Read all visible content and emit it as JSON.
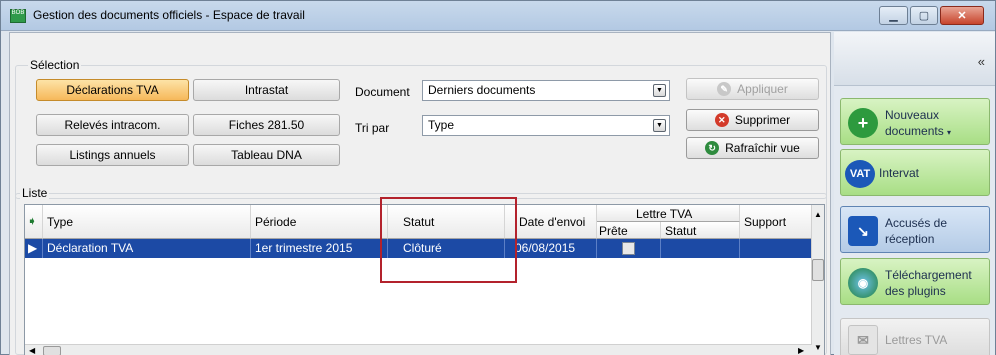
{
  "window": {
    "title": "Gestion des documents officiels - Espace de travail",
    "app_icon_text": "BOB"
  },
  "selection": {
    "group_label": "Sélection",
    "buttons": [
      {
        "label": "Déclarations TVA",
        "active": true
      },
      {
        "label": "Intrastat",
        "active": false
      },
      {
        "label": "Relevés intracom.",
        "active": false
      },
      {
        "label": "Fiches 281.50",
        "active": false
      },
      {
        "label": "Listings annuels",
        "active": false
      },
      {
        "label": "Tableau DNA",
        "active": false
      }
    ],
    "document_label": "Document",
    "document_value": "Derniers documents",
    "sort_label": "Tri par",
    "sort_value": "Type",
    "actions": {
      "apply": "Appliquer",
      "delete": "Supprimer",
      "refresh": "Rafraîchir vue"
    }
  },
  "list": {
    "group_label": "Liste",
    "columns": {
      "type": "Type",
      "period": "Période",
      "status": "Statut",
      "sent_date": "Date d'envoi",
      "vat_letter": "Lettre TVA",
      "ready": "Prête",
      "letter_status": "Statut",
      "support": "Support"
    },
    "rows": [
      {
        "type": "Déclaration TVA",
        "period": "1er trimestre 2015",
        "status": "Clôturé",
        "sent_date": "06/08/2015",
        "ready": false,
        "letter_status": "",
        "support": ""
      }
    ]
  },
  "sidebar": {
    "collapse_glyph": "«",
    "buttons": [
      {
        "label_line1": "Nouveaux",
        "label_line2": "documents",
        "icon": "plus-icon"
      },
      {
        "label_line1": "Intervat",
        "label_line2": "",
        "icon": "vat-icon",
        "icon_text": "VAT"
      },
      {
        "label_line1": "Accusés de",
        "label_line2": "réception",
        "icon": "arrow-down-icon"
      },
      {
        "label_line1": "Téléchargement",
        "label_line2": "des plugins",
        "icon": "globe-icon"
      },
      {
        "label_line1": "Lettres TVA",
        "label_line2": "",
        "icon": "letters-icon"
      }
    ]
  },
  "colors": {
    "active_button": "#f6b85a",
    "selected_row": "#1c4aa5",
    "sidebar_green": "#a8de85",
    "highlight_box": "#b3222c"
  }
}
